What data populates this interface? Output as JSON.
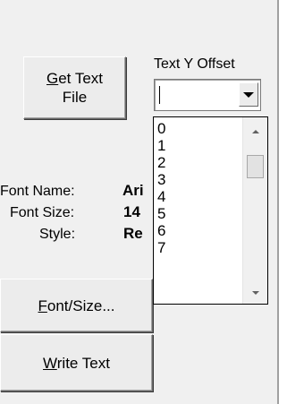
{
  "buttons": {
    "get_text_file": {
      "accel": "G",
      "rest_line1": "et Text",
      "line2": "File"
    },
    "font_size": {
      "accel": "F",
      "rest": "ont/Size..."
    },
    "write_text": {
      "accel": "W",
      "rest": "rite Text"
    }
  },
  "text_y_offset": {
    "label": "Text Y Offset",
    "value": "",
    "options": [
      "0",
      "1",
      "2",
      "3",
      "4",
      "5",
      "6",
      "7"
    ]
  },
  "font_info": {
    "name_label": "Font Name:",
    "name_value": "Ari",
    "size_label": "Font Size:",
    "size_value": "14",
    "style_label": "Style:",
    "style_value": "Re"
  },
  "icons": {
    "combo_dropdown": "chevron-down-icon",
    "scroll_up": "scroll-up-icon",
    "scroll_down": "scroll-down-icon"
  }
}
